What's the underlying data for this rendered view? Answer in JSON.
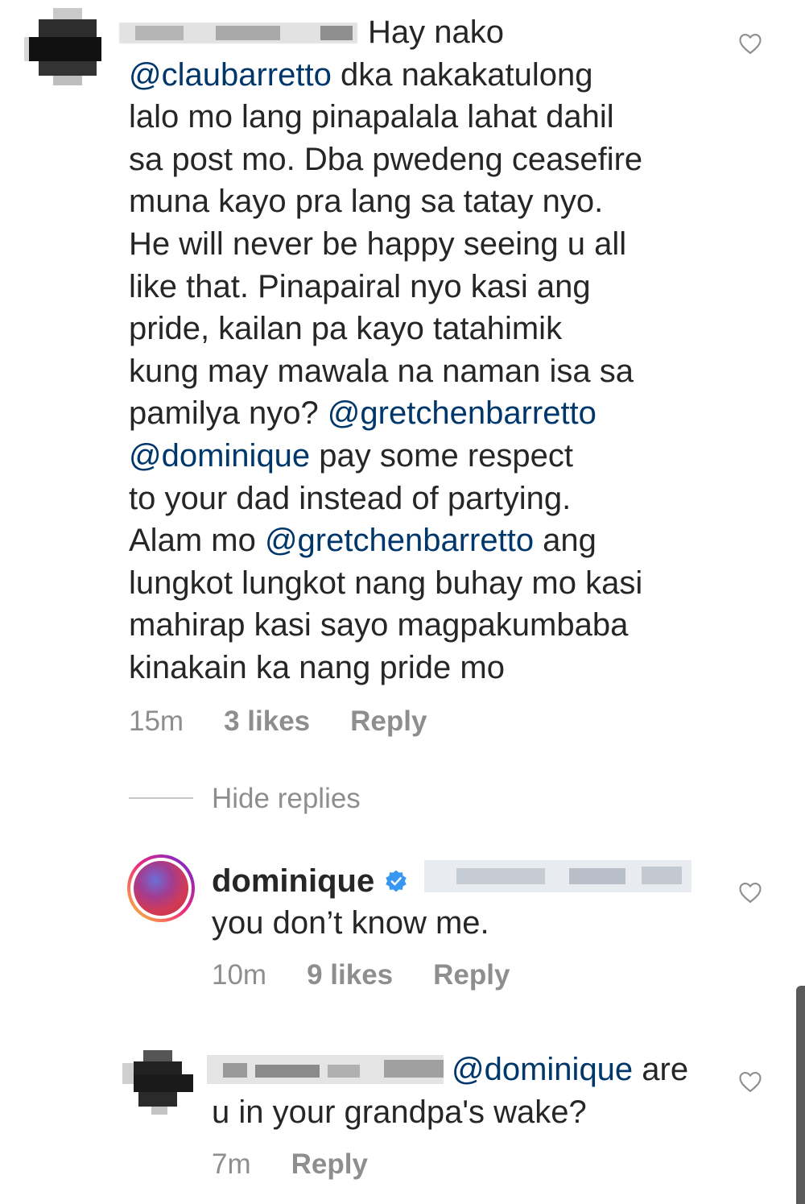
{
  "comment1": {
    "line0": "Hay nako",
    "line1_mention": "@claubarretto",
    "line1_rest": " dka nakakatulong",
    "line2": "lalo mo lang pinapalala lahat dahil",
    "line3": "sa post mo. Dba pwedeng ceasefire",
    "line4": "muna kayo pra lang sa tatay nyo.",
    "line5": "He will never be happy seeing u all",
    "line6": "like that. Pinapairal nyo kasi ang",
    "line7": "pride, kailan pa kayo tatahimik",
    "line8": "kung may mawala na naman isa sa",
    "line9_start": "pamilya nyo? ",
    "line9_mention": "@gretchenbarretto",
    "line10_mention": "@dominique",
    "line10_rest": " pay some respect",
    "line11": "to your dad instead of partying.",
    "line12_start": "Alam mo ",
    "line12_mention": "@gretchenbarretto",
    "line12_rest": " ang",
    "line13": "lungkot lungkot nang buhay mo kasi",
    "line14": "mahirap kasi sayo magpakumbaba",
    "line15": "kinakain ka nang pride mo",
    "time": "15m",
    "likes": "3 likes",
    "reply": "Reply"
  },
  "hide_replies": "Hide replies",
  "reply1": {
    "username": "dominique",
    "text": "you don’t know me.",
    "time": "10m",
    "likes": "9 likes",
    "reply": "Reply"
  },
  "reply2": {
    "mention": "@dominique",
    "rest": " are",
    "line2": "u in your grandpa's wake?",
    "time": "7m",
    "reply": "Reply"
  },
  "colors": {
    "text": "#262626",
    "mention": "#00376b",
    "meta": "#8e8e8e",
    "verified": "#3897f0"
  }
}
